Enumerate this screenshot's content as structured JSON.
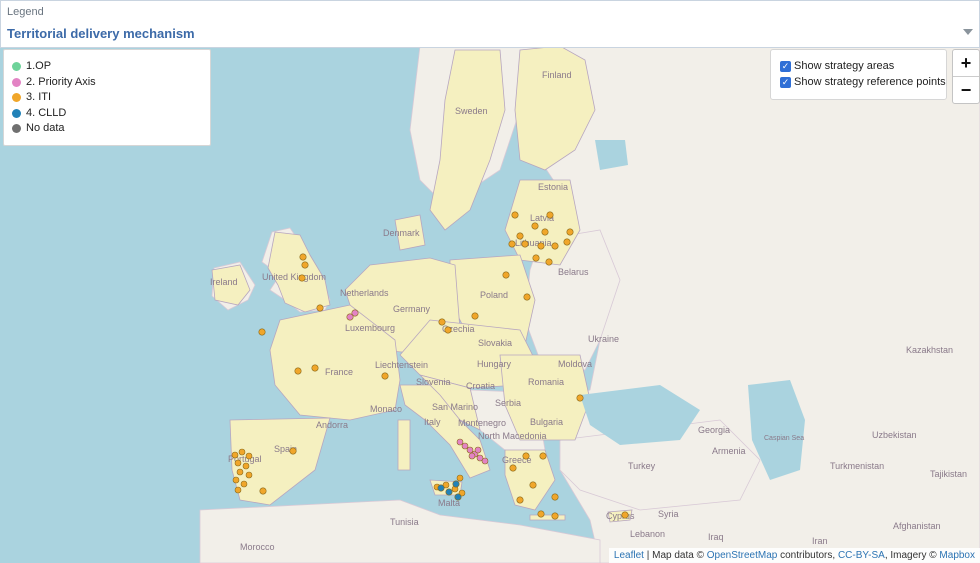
{
  "header": {
    "caption": "Legend",
    "selected": "Territorial delivery mechanism"
  },
  "legend": [
    {
      "label": "1.OP",
      "color": "#6ed39a"
    },
    {
      "label": "2. Priority Axis",
      "color": "#e383c4"
    },
    {
      "label": "3. ITI",
      "color": "#f0a62a"
    },
    {
      "label": "4. CLLD",
      "color": "#2282b8"
    },
    {
      "label": "No data",
      "color": "#707070"
    }
  ],
  "toggles": [
    {
      "label": "Show strategy areas",
      "checked": true
    },
    {
      "label": "Show strategy reference points",
      "checked": true
    }
  ],
  "zoom": {
    "in": "+",
    "out": "−"
  },
  "attribution": {
    "leaflet": "Leaflet",
    "sep1": " | Map data © ",
    "osm": "OpenStreetMap",
    "contrib": " contributors, ",
    "license": "CC-BY-SA",
    "imagery": ", Imagery © ",
    "mapbox": "Mapbox"
  },
  "map_labels": {
    "finland": "Finland",
    "sweden": "Sweden",
    "estonia": "Estonia",
    "latvia": "Latvia",
    "lithuania": "Lithuania",
    "denmark": "Denmark",
    "belarus": "Belarus",
    "ireland": "Ireland",
    "uk": "United Kingdom",
    "netherlands": "Netherlands",
    "germany": "Germany",
    "poland": "Poland",
    "luxembourg": "Luxembourg",
    "czechia": "Czechia",
    "slovakia": "Slovakia",
    "ukraine": "Ukraine",
    "kazakhstan": "Kazakhstan",
    "france": "France",
    "liechtenstein": "Liechtenstein",
    "hungary": "Hungary",
    "moldova": "Moldova",
    "slovenia": "Slovenia",
    "croatia": "Croatia",
    "romania": "Romania",
    "monaco": "Monaco",
    "san_marino": "San Marino",
    "serbia": "Serbia",
    "andorra": "Andorra",
    "italy": "Italy",
    "montenegro": "Montenegro",
    "bulgaria": "Bulgaria",
    "georgia": "Georgia",
    "uzbekistan": "Uzbekistan",
    "north_macedonia": "North Macedonia",
    "portugal": "Portugal",
    "spain": "Spain",
    "armenia": "Armenia",
    "greece": "Greece",
    "turkey": "Turkey",
    "turkmenistan": "Turkmenistan",
    "tajikistan": "Tajikistan",
    "caspian": "Caspian Sea",
    "cyprus": "Cyprus",
    "syria": "Syria",
    "malta": "Malta",
    "tunisia": "Tunisia",
    "lebanon": "Lebanon",
    "iraq": "Iraq",
    "afghanistan": "Afghanistan",
    "morocco": "Morocco",
    "iran": "Iran"
  }
}
